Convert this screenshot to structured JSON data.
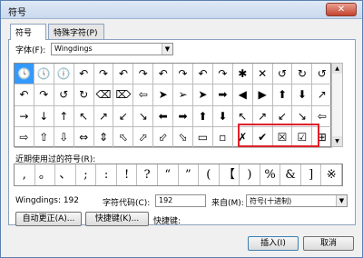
{
  "window": {
    "title": "符号",
    "close_label": "✕"
  },
  "tabs": [
    "符号",
    "特殊字符(P)"
  ],
  "font": {
    "label": "字体(F):",
    "value": "Wingdings"
  },
  "symbols": [
    "🕓",
    "🕔",
    "🕕",
    "↶",
    "↷",
    "↶",
    "↷",
    "↶",
    "↷",
    "↶",
    "↷",
    "✱",
    "✕",
    "↺",
    "↻",
    "↺",
    "↶",
    "↷",
    "↺",
    "↻",
    "⌫",
    "⌦",
    "⇦",
    "➤",
    "➢",
    "➤",
    "➡",
    "◀",
    "▶",
    "⬆",
    "⬇",
    "↗",
    "→",
    "↓",
    "↑",
    "↖",
    "↗",
    "↙",
    "↘",
    "⬅",
    "➡",
    "⬆",
    "⬇",
    "↖",
    "↗",
    "↙",
    "↘",
    "⇦",
    "⇨",
    "⇧",
    "⇩",
    "⇔",
    "⇕",
    "⬁",
    "⬀",
    "⬃",
    "⬂",
    "▭",
    "▫",
    "✗",
    "✔",
    "☒",
    "☑",
    "⊞"
  ],
  "recent": {
    "label": "近期使用过的符号(R):",
    "items": [
      ",",
      "。",
      "、",
      ";",
      ":",
      "!",
      "?",
      "“",
      "”",
      "(",
      "【",
      ")",
      "%",
      "&",
      "]",
      "※"
    ]
  },
  "info": {
    "name_value": "Wingdings: 192",
    "code_label": "字符代码(C):",
    "code_value": "192",
    "from_label": "来自(M):",
    "from_value": "符号(十进制)"
  },
  "buttons": {
    "autocorrect": "自动更正(A)...",
    "shortcut": "快捷键(K)...",
    "shortcut_label": "快捷键:",
    "insert": "插入(I)",
    "cancel": "取消"
  },
  "colors": {
    "accent": "#3399ff",
    "highlight": "#e0202a"
  }
}
